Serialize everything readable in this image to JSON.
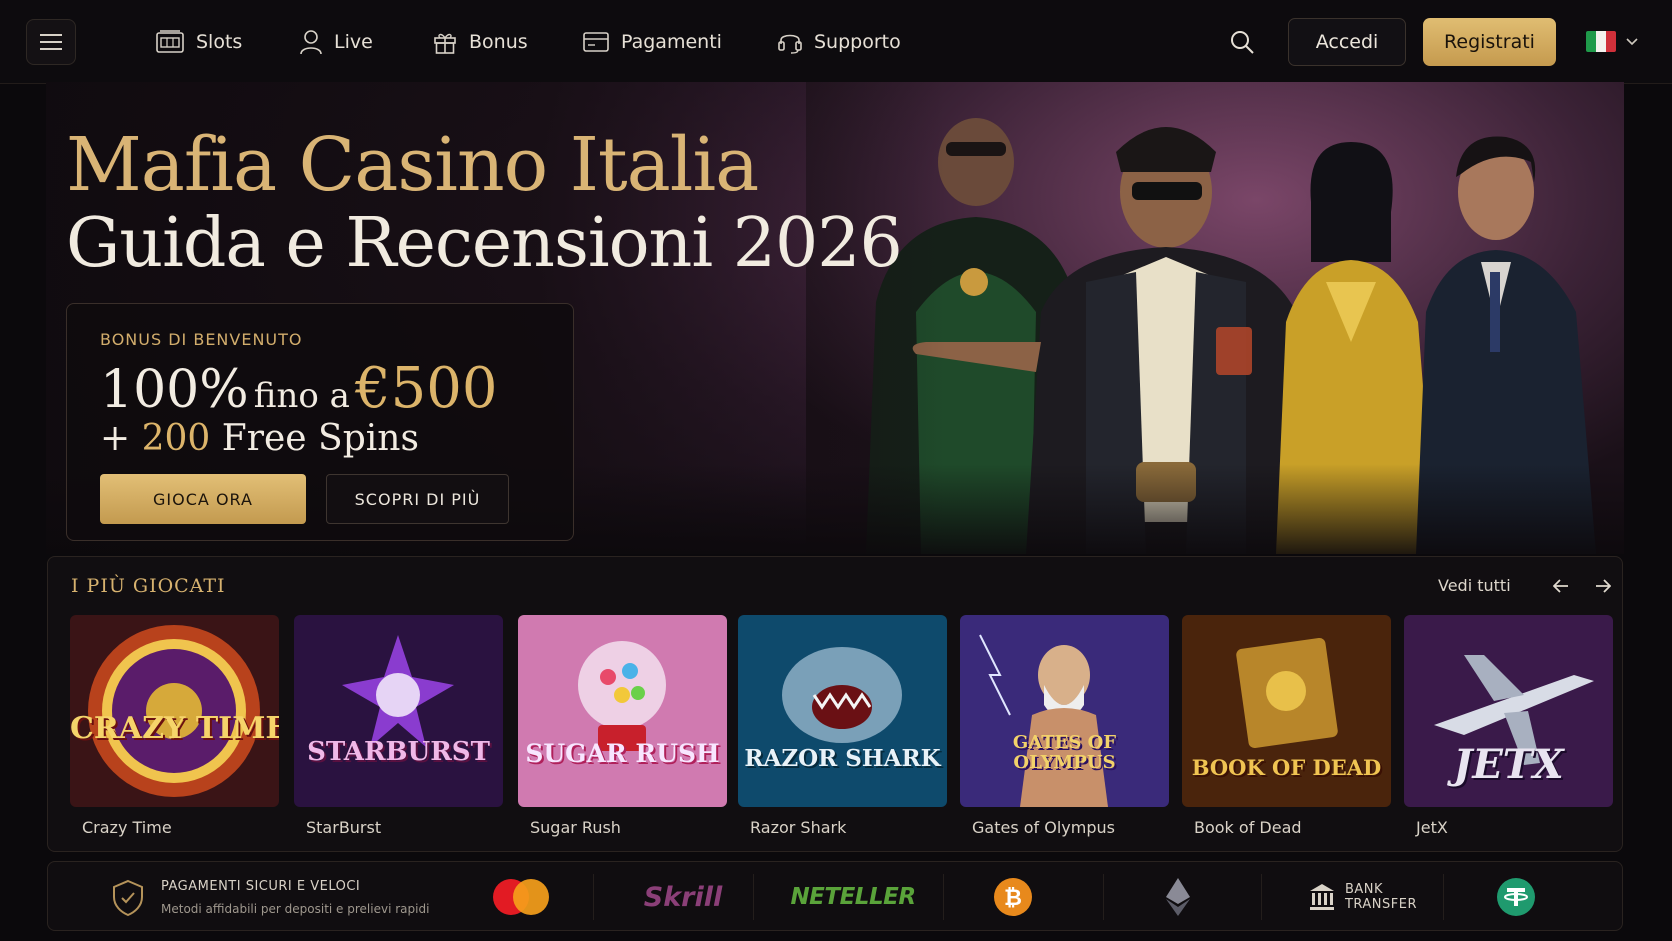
{
  "header": {
    "nav": [
      {
        "label": "Slots",
        "icon": "slot-machine-icon"
      },
      {
        "label": "Live",
        "icon": "user-icon"
      },
      {
        "label": "Bonus",
        "icon": "gift-icon"
      },
      {
        "label": "Pagamenti",
        "icon": "credit-card-icon"
      },
      {
        "label": "Supporto",
        "icon": "headset-icon"
      }
    ],
    "login_label": "Accedi",
    "register_label": "Registrati",
    "language": "it"
  },
  "hero": {
    "title_line1": "Mafia Casino Italia",
    "title_line2": "Guida e Recensioni 2026",
    "bonus": {
      "eyebrow": "BONUS DI BENVENUTO",
      "percent": "100%",
      "upto": "fino a",
      "amount": "€500",
      "plus": "+",
      "spins_count": "200",
      "spins_label": "Free Spins"
    },
    "play_button": "GIOCA ORA",
    "more_button": "SCOPRI DI PIÙ"
  },
  "games": {
    "title": "I PIÙ GIOCATI",
    "see_all": "Vedi tutti",
    "items": [
      {
        "name": "Crazy Time",
        "logo": "CRAZY TIME"
      },
      {
        "name": "StarBurst",
        "logo": "STARBURST"
      },
      {
        "name": "Sugar Rush",
        "logo": "SUGAR RUSH"
      },
      {
        "name": "Razor Shark",
        "logo": "RAZOR SHARK"
      },
      {
        "name": "Gates of Olympus",
        "logo": "GATES OF OLYMPUS"
      },
      {
        "name": "Book of Dead",
        "logo": "BOOK OF DEAD"
      },
      {
        "name": "JetX",
        "logo": "JETX"
      }
    ]
  },
  "payments": {
    "title": "PAGAMENTI SICURI E VELOCI",
    "subtitle": "Metodi affidabili per depositi e prelievi rapidi",
    "skrill": "Skrill",
    "neteller": "NETELLER",
    "bank_line1": "BANK",
    "bank_line2": "TRANSFER"
  },
  "colors": {
    "gold": "#d9b475",
    "background": "#0b090c",
    "register_button": "#d6b064"
  }
}
